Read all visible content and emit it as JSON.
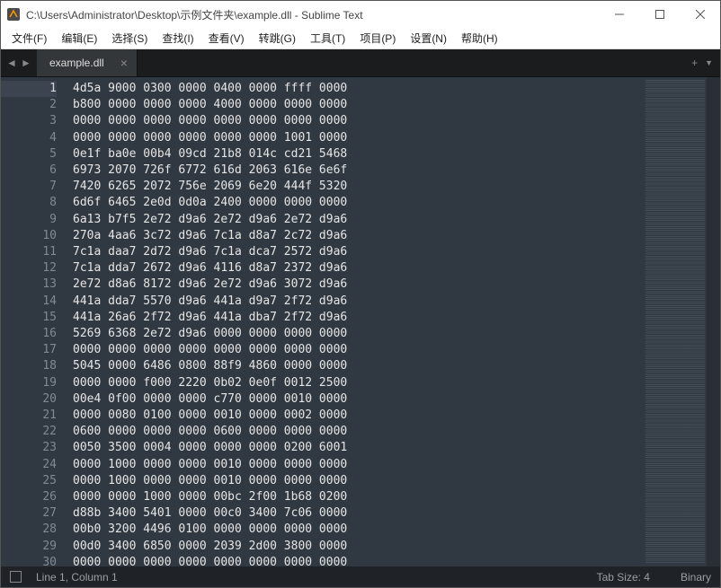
{
  "titlebar": {
    "title": "C:\\Users\\Administrator\\Desktop\\示例文件夹\\example.dll - Sublime Text"
  },
  "menu": {
    "file": "文件(F)",
    "edit": "编辑(E)",
    "select": "选择(S)",
    "find": "查找(I)",
    "view": "查看(V)",
    "goto": "转跳(G)",
    "tools": "工具(T)",
    "project": "项目(P)",
    "prefs": "设置(N)",
    "help": "帮助(H)"
  },
  "tabbar": {
    "nav_prev": "◄",
    "nav_next": "►",
    "tab_label": "example.dll",
    "tab_close": "×",
    "add": "+",
    "overflow": "▼"
  },
  "editor": {
    "first_line": 1,
    "lines": [
      "4d5a 9000 0300 0000 0400 0000 ffff 0000",
      "b800 0000 0000 0000 4000 0000 0000 0000",
      "0000 0000 0000 0000 0000 0000 0000 0000",
      "0000 0000 0000 0000 0000 0000 1001 0000",
      "0e1f ba0e 00b4 09cd 21b8 014c cd21 5468",
      "6973 2070 726f 6772 616d 2063 616e 6e6f",
      "7420 6265 2072 756e 2069 6e20 444f 5320",
      "6d6f 6465 2e0d 0d0a 2400 0000 0000 0000",
      "6a13 b7f5 2e72 d9a6 2e72 d9a6 2e72 d9a6",
      "270a 4aa6 3c72 d9a6 7c1a d8a7 2c72 d9a6",
      "7c1a daa7 2d72 d9a6 7c1a dca7 2572 d9a6",
      "7c1a dda7 2672 d9a6 4116 d8a7 2372 d9a6",
      "2e72 d8a6 8172 d9a6 2e72 d9a6 3072 d9a6",
      "441a dda7 5570 d9a6 441a d9a7 2f72 d9a6",
      "441a 26a6 2f72 d9a6 441a dba7 2f72 d9a6",
      "5269 6368 2e72 d9a6 0000 0000 0000 0000",
      "0000 0000 0000 0000 0000 0000 0000 0000",
      "5045 0000 6486 0800 88f9 4860 0000 0000",
      "0000 0000 f000 2220 0b02 0e0f 0012 2500",
      "00e4 0f00 0000 0000 c770 0000 0010 0000",
      "0000 0080 0100 0000 0010 0000 0002 0000",
      "0600 0000 0000 0000 0600 0000 0000 0000",
      "0050 3500 0004 0000 0000 0000 0200 6001",
      "0000 1000 0000 0000 0010 0000 0000 0000",
      "0000 1000 0000 0000 0010 0000 0000 0000",
      "0000 0000 1000 0000 00bc 2f00 1b68 0200",
      "d88b 3400 5401 0000 00c0 3400 7c06 0000",
      "00b0 3200 4496 0100 0000 0000 0000 0000",
      "00d0 3400 6850 0000 2039 2d00 3800 0000",
      "0000 0000 0000 0000 0000 0000 0000 0000"
    ]
  },
  "status": {
    "position": "Line 1, Column 1",
    "tabsize": "Tab Size: 4",
    "syntax": "Binary"
  }
}
